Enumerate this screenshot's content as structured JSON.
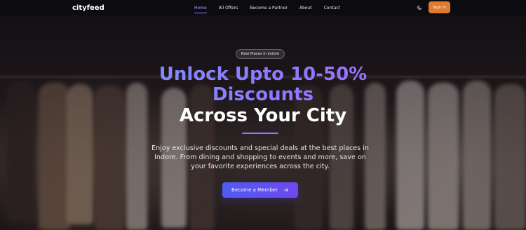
{
  "brand": {
    "logo_text": "cityfeed"
  },
  "nav": {
    "links": [
      {
        "label": "Home",
        "active": true
      },
      {
        "label": "All Offers",
        "active": false
      },
      {
        "label": "Become a Partner",
        "active": false
      },
      {
        "label": "About",
        "active": false
      },
      {
        "label": "Contact",
        "active": false
      }
    ],
    "theme_toggle_icon": "moon-icon",
    "signin_label": "Sign In"
  },
  "hero": {
    "badge": "Best Places in Indore",
    "headline_gradient_line1": "Unlock Upto 10-50%",
    "headline_gradient_line2": "Discounts",
    "headline_white": "Across Your City",
    "subtext": "Enjoy exclusive discounts and special deals at the best places in Indore. From dining and shopping to events and more, save on your favorite experiences across the city.",
    "cta_label": "Become a Member",
    "cta_icon": "arrow-right-icon"
  },
  "colors": {
    "accent_primary": "#6e48f0",
    "accent_signin": "#e07a2c",
    "nav_active": "#a7a4ff",
    "headline_gradient_start": "#6fa3ff",
    "headline_gradient_end": "#a26bff"
  }
}
